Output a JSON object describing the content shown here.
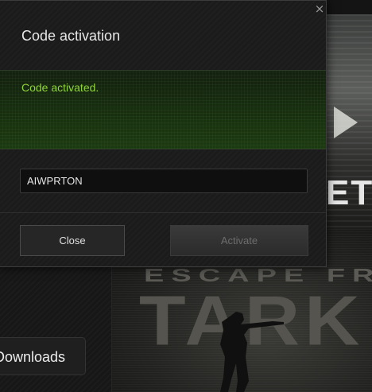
{
  "background": {
    "video_title_fragment": "ETE",
    "banner_line1": "ESCAPE FR",
    "banner_line2": "TARK",
    "downloads_label": "Downloads"
  },
  "modal": {
    "title": "Code activation",
    "close_icon": "×",
    "status_text": "Code activated.",
    "code_value": "AIWPRTON",
    "close_label": "Close",
    "activate_label": "Activate",
    "status_color": "#8fd43a"
  },
  "icons": {
    "close": "close-icon",
    "play": "play-icon"
  }
}
